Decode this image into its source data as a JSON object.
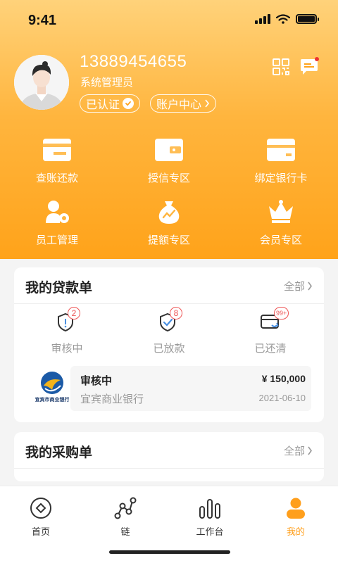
{
  "status_bar": {
    "time": "9:41"
  },
  "profile": {
    "phone": "13889454655",
    "role": "系统管理员",
    "verified_label": "已认证",
    "account_center_label": "账户中心"
  },
  "quick_actions": [
    {
      "label": "查账还款",
      "icon": "card-icon"
    },
    {
      "label": "授信专区",
      "icon": "wallet-icon"
    },
    {
      "label": "绑定银行卡",
      "icon": "bank-card-icon"
    },
    {
      "label": "员工管理",
      "icon": "employee-icon"
    },
    {
      "label": "提额专区",
      "icon": "money-bag-icon"
    },
    {
      "label": "会员专区",
      "icon": "crown-icon"
    }
  ],
  "loans": {
    "title": "我的贷款单",
    "all_label": "全部",
    "stats": [
      {
        "label": "审核中",
        "badge": "2",
        "icon": "shield-alert-icon"
      },
      {
        "label": "已放款",
        "badge": "8",
        "icon": "shield-check-icon"
      },
      {
        "label": "已还清",
        "badge": "99+",
        "icon": "card-refresh-icon"
      }
    ],
    "item": {
      "status": "审核中",
      "amount": "¥ 150,000",
      "bank": "宜宾商业银行",
      "date": "2021-06-10",
      "logo_text": "宜宾市商业银行"
    }
  },
  "purchases": {
    "title": "我的采购单",
    "all_label": "全部"
  },
  "tab_bar": {
    "tabs": [
      {
        "label": "首页",
        "icon": "home-diamond-icon",
        "active": false
      },
      {
        "label": "链",
        "icon": "chain-nodes-icon",
        "active": false
      },
      {
        "label": "工作台",
        "icon": "bar-chart-icon",
        "active": false
      },
      {
        "label": "我的",
        "icon": "user-icon",
        "active": true
      }
    ]
  },
  "colors": {
    "accent": "#ffa31a",
    "badge": "#e55555",
    "tab_active": "#ff9f1c"
  }
}
